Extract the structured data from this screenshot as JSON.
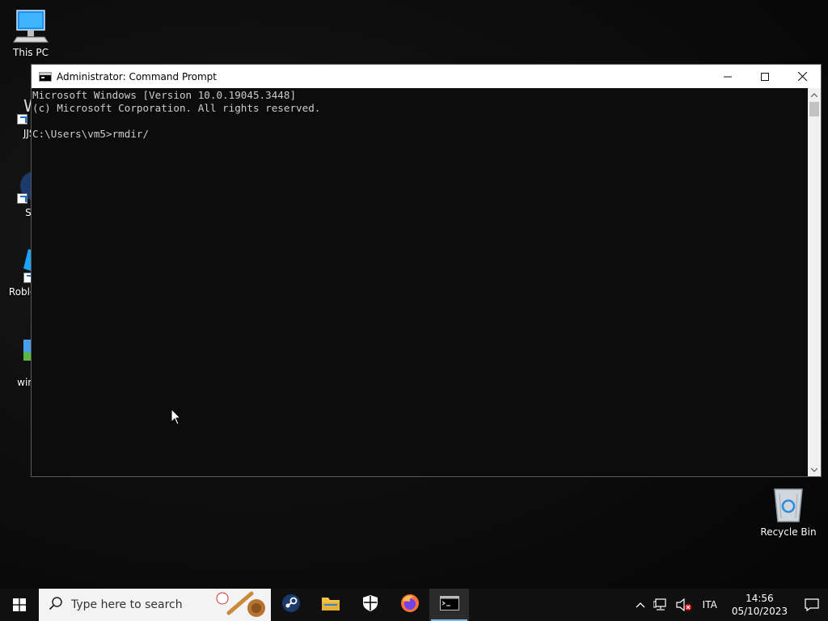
{
  "desktop": {
    "icons": [
      {
        "label": "This PC"
      },
      {
        "label": "JJSp"
      },
      {
        "label": "Ste"
      },
      {
        "label": "Roblox"
      },
      {
        "label": "windo"
      },
      {
        "label": "Recycle Bin"
      }
    ]
  },
  "window": {
    "title": "Administrator: Command Prompt",
    "lines": [
      "Microsoft Windows [Version 10.0.19045.3448]",
      "(c) Microsoft Corporation. All rights reserved.",
      "",
      "C:\\Users\\vm5>rmdir/"
    ]
  },
  "taskbar": {
    "search_placeholder": "Type here to search",
    "apps": [
      "steam-icon",
      "file-explorer-icon",
      "security-shield-icon",
      "firefox-icon",
      "command-prompt-icon"
    ],
    "language": "ITA",
    "time": "14:56",
    "date": "05/10/2023"
  },
  "colors": {
    "console_bg": "#0c0c0c",
    "console_text": "#cccccc",
    "taskbar_bg": "#101010",
    "active_indicator": "#76b9ed"
  }
}
